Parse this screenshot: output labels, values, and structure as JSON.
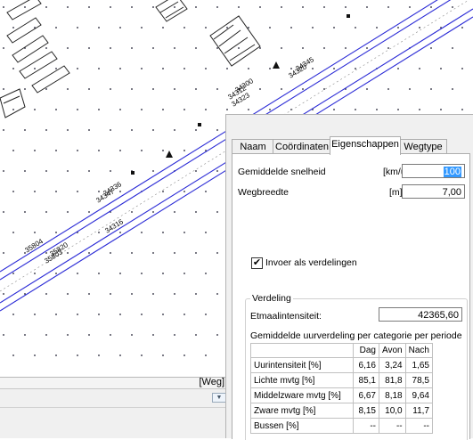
{
  "map": {
    "labels": [
      "34312",
      "34300",
      "34323",
      "34320",
      "34345",
      "34347",
      "34336",
      "34316",
      "35804",
      "35803",
      "35820"
    ]
  },
  "dock": {
    "label": "[Weg]",
    "arrow": "▼"
  },
  "panel": {
    "tabs": [
      "Naam",
      "Coördinaten",
      "Eigenschappen",
      "Wegtype"
    ],
    "active_tab": "Eigenschappen",
    "speed": {
      "label": "Gemiddelde snelheid",
      "unit": "[km/u]",
      "value": "100"
    },
    "width": {
      "label": "Wegbreedte",
      "unit": "[m]",
      "value": "7,00"
    },
    "distribution_checkbox": {
      "label": "Invoer als verdelingen",
      "checked": true,
      "mark": "✔"
    },
    "group": {
      "title": "Verdeling",
      "etmaal_label": "Etmaalintensiteit:",
      "etmaal_value": "42365,60",
      "subtitle": "Gemiddelde uurverdeling per categorie per periode"
    },
    "table": {
      "columns": [
        "Dag",
        "Avon",
        "Nach"
      ],
      "rows": [
        {
          "label": "Uurintensiteit [%]",
          "values": [
            "6,16",
            "3,24",
            "1,65"
          ]
        },
        {
          "label": "Lichte mvtg [%]",
          "values": [
            "85,1",
            "81,8",
            "78,5"
          ]
        },
        {
          "label": "Middelzware mvtg [%]",
          "values": [
            "6,67",
            "8,18",
            "9,64"
          ]
        },
        {
          "label": "Zware mvtg [%]",
          "values": [
            "8,15",
            "10,0",
            "11,7"
          ]
        },
        {
          "label": "Bussen [%]",
          "values": [
            "--",
            "--",
            "--"
          ]
        }
      ]
    }
  }
}
